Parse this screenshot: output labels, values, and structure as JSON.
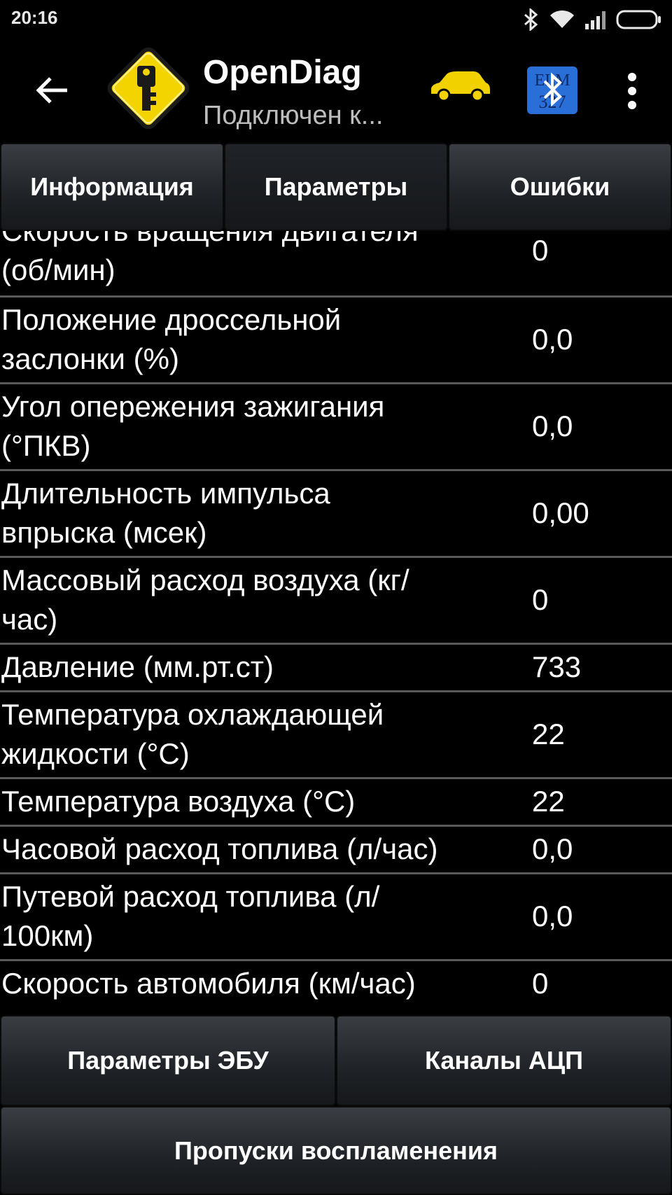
{
  "status_bar": {
    "time": "20:16",
    "icons": [
      "bluetooth-icon",
      "wifi-icon",
      "signal-icon",
      "battery-icon"
    ]
  },
  "action_bar": {
    "title": "OpenDiag",
    "subtitle": "Подключен к...",
    "icons": [
      "back-arrow-icon",
      "app-logo-icon",
      "car-icon",
      "elm327-bluetooth-icon",
      "more-vert-icon"
    ],
    "colors": {
      "car": "#f2d100",
      "elm_bg": "#2a6fd8"
    },
    "elm_text_top": "ELM",
    "elm_text_bottom": "327"
  },
  "tabs": [
    {
      "label": "Информация",
      "active": false
    },
    {
      "label": "Параметры",
      "active": true
    },
    {
      "label": "Ошибки",
      "active": false
    }
  ],
  "parameters": [
    {
      "name_line1": "Скорость вращения двигателя",
      "name_line2": "(об/мин)",
      "value": "0"
    },
    {
      "name_line1": "Положение дроссельной",
      "name_line2": "заслонки (%)",
      "value": "0,0"
    },
    {
      "name_line1": "Угол опережения зажигания",
      "name_line2": "(°ПКВ)",
      "value": "0,0"
    },
    {
      "name_line1": "Длительность импульса",
      "name_line2": "впрыска (мсек)",
      "value": "0,00"
    },
    {
      "name_line1": "Массовый расход воздуха (кг/",
      "name_line2": "час)",
      "value": "0"
    },
    {
      "name_line1": "Давление (мм.рт.ст)",
      "name_line2": "",
      "value": "733"
    },
    {
      "name_line1": "Температура охлаждающей",
      "name_line2": "жидкости (°C)",
      "value": "22"
    },
    {
      "name_line1": "Температура воздуха (°C)",
      "name_line2": "",
      "value": "22"
    },
    {
      "name_line1": "Часовой расход топлива (л/час)",
      "name_line2": "",
      "value": "0,0"
    },
    {
      "name_line1": "Путевой расход топлива (л/",
      "name_line2": "100км)",
      "value": "0,0"
    },
    {
      "name_line1": "Скорость автомобиля (км/час)",
      "name_line2": "",
      "value": "0"
    }
  ],
  "bottom_buttons": {
    "ecu_params": "Параметры ЭБУ",
    "adc_channels": "Каналы АЦП",
    "misfires": "Пропуски воспламенения"
  }
}
